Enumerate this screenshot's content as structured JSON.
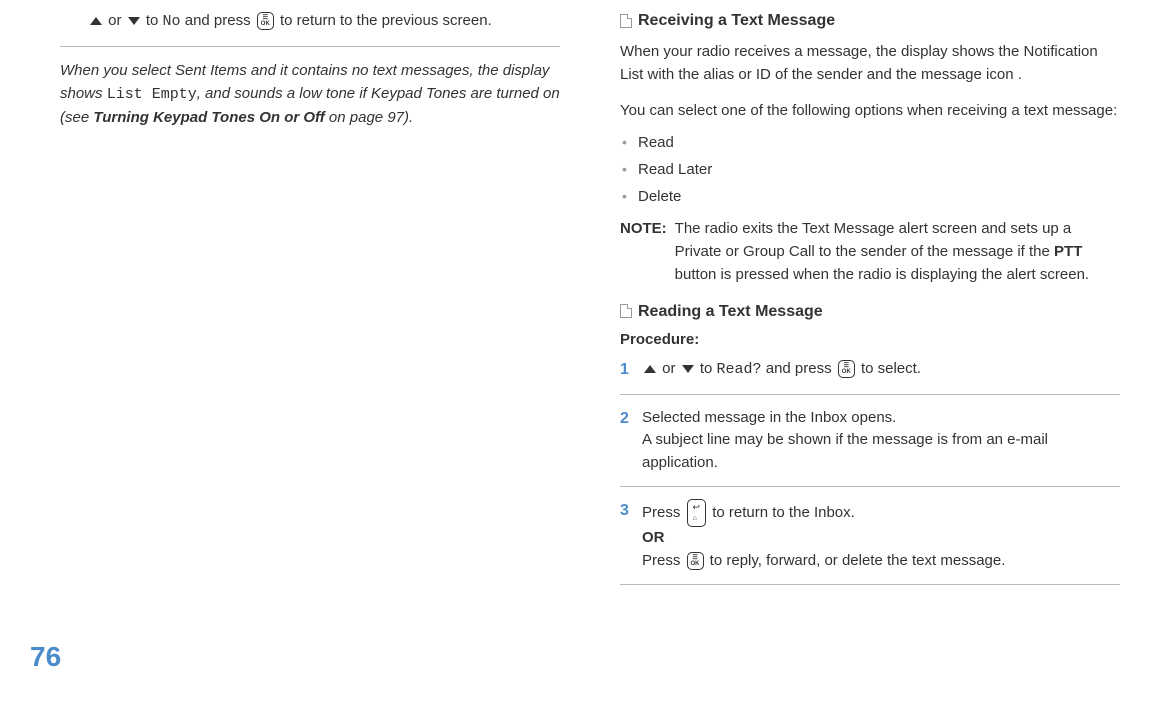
{
  "page_number": "76",
  "left": {
    "step_fragment": {
      "or": " or ",
      "to": " to ",
      "no": "No",
      "and_press": " and press ",
      "return": " to return to the previous screen."
    },
    "italic": {
      "p1a": "When you select Sent Items and it contains no text messages, the display shows ",
      "list_empty": "List Empty",
      "p1b": ", and sounds a low tone if Keypad Tones are turned on (see ",
      "ref": "Turning Keypad Tones On or Off",
      "p1c": " on page 97)."
    }
  },
  "right": {
    "h1": "Receiving a Text Message",
    "p1": "When your radio receives a message, the display shows the Notification List with the alias or ID of the sender and the message icon .",
    "p2": "You can select one of the following options when receiving a text message:",
    "bullets": [
      "Read",
      "Read Later",
      "Delete"
    ],
    "note_label": "NOTE:",
    "note_text_a": "The radio exits the Text Message alert screen and sets up a Private or Group Call to the sender of the message if the ",
    "note_ptt": "PTT",
    "note_text_b": " button is pressed when the radio is displaying the alert screen.",
    "h2": "Reading a Text Message",
    "procedure_label": "Procedure:",
    "step1": {
      "num": "1",
      "or": " or ",
      "to": " to ",
      "read": "Read?",
      "and_press": " and press ",
      "select": " to select."
    },
    "step2": {
      "num": "2",
      "line1": "Selected message in the Inbox opens.",
      "line2": "A subject line may be shown if the message is from an e-mail application."
    },
    "step3": {
      "num": "3",
      "press": "Press ",
      "return": " to return to the Inbox.",
      "or": "OR",
      "press2": "Press ",
      "reply": " to reply, forward, or delete the text message."
    }
  }
}
